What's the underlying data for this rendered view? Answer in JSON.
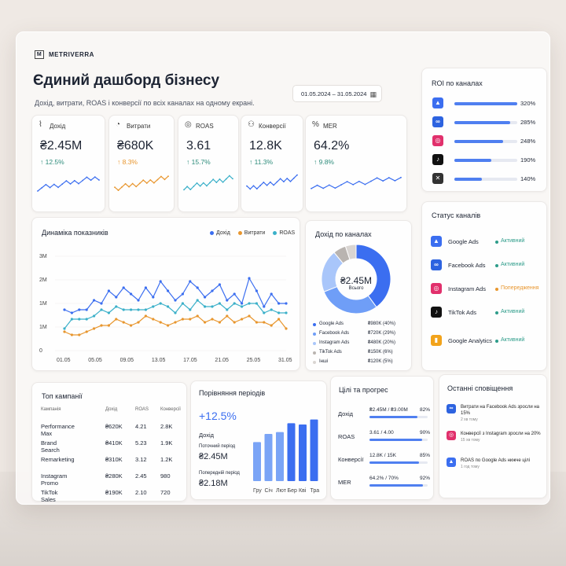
{
  "app": {
    "brand": "METRIVERRA",
    "title": "Єдиний дашборд бізнесу",
    "subtitle": "Дохід, витрати, ROAS і конверсії по всіх каналах на одному екрані.",
    "date_range": "01.05.2024 – 31.05.2024"
  },
  "kpis": [
    {
      "label": "Дохід",
      "value": "₴2.45M",
      "change": "↑ 12.5%",
      "color": "#2d8c7b",
      "line": "#3b6ef0"
    },
    {
      "label": "Витрати",
      "value": "₴680K",
      "change": "↑ 8.3%",
      "color": "#e8962e",
      "line": "#e8962e"
    },
    {
      "label": "ROAS",
      "value": "3.61",
      "change": "↑ 15.7%",
      "color": "#2d8c7b",
      "line": "#3bb0c9"
    },
    {
      "label": "Конверсії",
      "value": "12.8K",
      "change": "↑ 11.3%",
      "color": "#2d8c7b",
      "line": "#3b6ef0"
    },
    {
      "label": "MER",
      "value": "64.2%",
      "change": "↑ 9.8%",
      "color": "#2d8c7b",
      "line": "#3b6ef0"
    }
  ],
  "dynamics": {
    "title": "Динаміка показників",
    "legend": [
      "Дохід",
      "Витрати",
      "ROAS"
    ],
    "colors": [
      "#3b6ef0",
      "#e8962e",
      "#3bb0c9"
    ],
    "yticks": [
      "3M",
      "2M",
      "1M",
      "1M",
      "0"
    ],
    "xticks": [
      "01.05",
      "05.05",
      "09.05",
      "13.05",
      "17.05",
      "21.05",
      "25.05",
      "31.05"
    ]
  },
  "chart_data": {
    "type": "line",
    "title": "Динаміка показників",
    "x": [
      "01.05",
      "05.05",
      "09.05",
      "13.05",
      "17.05",
      "21.05",
      "25.05",
      "31.05"
    ],
    "series": [
      {
        "name": "Дохід",
        "values": [
          1.3,
          1.2,
          1.3,
          1.3,
          1.6,
          1.5,
          1.9,
          1.7,
          2.0,
          1.8,
          1.6,
          2.0,
          1.7,
          2.2,
          1.9,
          1.6,
          1.8,
          2.2,
          2.0,
          1.7,
          1.9,
          2.1,
          1.6,
          1.8,
          1.5,
          2.3,
          1.9,
          1.4,
          1.8,
          1.5,
          1.5
        ]
      },
      {
        "name": "Витрати",
        "values": [
          0.6,
          0.5,
          0.5,
          0.6,
          0.7,
          0.8,
          0.8,
          1.0,
          0.9,
          0.8,
          0.9,
          1.1,
          1.0,
          0.9,
          0.8,
          0.9,
          1.0,
          1.0,
          1.1,
          0.9,
          1.0,
          0.9,
          1.1,
          0.9,
          1.0,
          1.1,
          0.9,
          0.9,
          0.8,
          1.0,
          0.7
        ]
      },
      {
        "name": "ROAS",
        "values": [
          0.7,
          1.0,
          1.0,
          1.0,
          1.1,
          1.3,
          1.2,
          1.4,
          1.3,
          1.3,
          1.3,
          1.3,
          1.4,
          1.5,
          1.4,
          1.2,
          1.5,
          1.3,
          1.6,
          1.4,
          1.4,
          1.5,
          1.3,
          1.5,
          1.4,
          1.5,
          1.5,
          1.2,
          1.3,
          1.2,
          1.2
        ]
      }
    ]
  },
  "donut": {
    "title": "Дохід по каналах",
    "center_value": "₴2.45M",
    "center_label": "Всього",
    "items": [
      {
        "name": "Google Ads",
        "value": "₴980K (40%)",
        "pct": 40,
        "color": "#3b6ef0"
      },
      {
        "name": "Facebook Ads",
        "value": "₴720K (29%)",
        "pct": 29,
        "color": "#6f9ef7"
      },
      {
        "name": "Instagram Ads",
        "value": "₴480K (20%)",
        "pct": 20,
        "color": "#a9c6fa"
      },
      {
        "name": "TikTok Ads",
        "value": "₴150K (6%)",
        "pct": 6,
        "color": "#b9b4b0"
      },
      {
        "name": "Інші",
        "value": "₴120K (5%)",
        "pct": 5,
        "color": "#d9d5d2"
      }
    ]
  },
  "roi": {
    "title": "ROI по каналах",
    "items": [
      {
        "icon": "google-ads-icon",
        "glyph": "▲",
        "color": "#3b6ef0",
        "value": "320%",
        "pct": 100
      },
      {
        "icon": "meta-icon",
        "glyph": "∞",
        "color": "#2d63e0",
        "value": "285%",
        "pct": 89
      },
      {
        "icon": "instagram-icon",
        "glyph": "◎",
        "color": "#e1306c",
        "value": "248%",
        "pct": 77
      },
      {
        "icon": "tiktok-icon",
        "glyph": "♪",
        "color": "#111111",
        "value": "190%",
        "pct": 59
      },
      {
        "icon": "other-icon",
        "glyph": "✕",
        "color": "#333333",
        "value": "140%",
        "pct": 44
      }
    ]
  },
  "status": {
    "title": "Статус каналів",
    "items": [
      {
        "name": "Google Ads",
        "state": "Активний",
        "color": "#2d9c8a",
        "glyph": "▲",
        "ic": "#3b6ef0"
      },
      {
        "name": "Facebook Ads",
        "state": "Активний",
        "color": "#2d9c8a",
        "glyph": "∞",
        "ic": "#2d63e0"
      },
      {
        "name": "Instagram Ads",
        "state": "Попередження",
        "color": "#e8962e",
        "glyph": "◎",
        "ic": "#e1306c"
      },
      {
        "name": "TikTok Ads",
        "state": "Активний",
        "color": "#2d9c8a",
        "glyph": "♪",
        "ic": "#111111"
      },
      {
        "name": "Google Analytics",
        "state": "Активний",
        "color": "#2d9c8a",
        "glyph": "▮",
        "ic": "#f2a31b"
      }
    ]
  },
  "campaigns": {
    "title": "Топ кампанії",
    "headers": [
      "Кампанія",
      "Дохід",
      "ROAS",
      "Конверсії"
    ],
    "rows": [
      [
        "Performance Max",
        "₴620K",
        "4.21",
        "2.8K"
      ],
      [
        "Brand Search",
        "₴410K",
        "5.23",
        "1.9K"
      ],
      [
        "Remarketing",
        "₴310K",
        "3.12",
        "1.2K"
      ],
      [
        "Instagram Promo",
        "₴280K",
        "2.45",
        "980"
      ],
      [
        "TikTok Sales",
        "₴190K",
        "2.10",
        "720"
      ]
    ]
  },
  "compare": {
    "title": "Порівняння періодів",
    "change": "+12.5%",
    "metric": "Дохід",
    "current_label": "Поточний період",
    "current_value": "₴2.45M",
    "previous_label": "Попередній період",
    "previous_value": "₴2.18M",
    "bars": [
      {
        "label": "Гру",
        "v": 0.62
      },
      {
        "label": "Січ",
        "v": 0.75
      },
      {
        "label": "Лют",
        "v": 0.78
      },
      {
        "label": "Бер",
        "v": 0.92
      },
      {
        "label": "Кві",
        "v": 0.9
      },
      {
        "label": "Тра",
        "v": 0.98
      }
    ]
  },
  "goals": {
    "title": "Цілі та прогрес",
    "items": [
      {
        "name": "Дохід",
        "value": "₴2.45M / ₴3.00M",
        "pct": "82%",
        "p": 82
      },
      {
        "name": "ROAS",
        "value": "3.61 / 4.00",
        "pct": "90%",
        "p": 90
      },
      {
        "name": "Конверсії",
        "value": "12.8K / 15K",
        "pct": "85%",
        "p": 85
      },
      {
        "name": "MER",
        "value": "64.2% / 70%",
        "pct": "92%",
        "p": 92
      }
    ]
  },
  "notifications": {
    "title": "Останні сповіщення",
    "items": [
      {
        "text": "Витрати на Facebook Ads зросли на 15%",
        "time": "2 хв тому",
        "glyph": "∞",
        "ic": "#2d63e0"
      },
      {
        "text": "Конверсії з Instagram зросли на 20%",
        "time": "15 хв тому",
        "glyph": "◎",
        "ic": "#e1306c"
      },
      {
        "text": "ROAS по Google Ads нижче цілі",
        "time": "1 год тому",
        "glyph": "▲",
        "ic": "#3b6ef0"
      }
    ]
  }
}
